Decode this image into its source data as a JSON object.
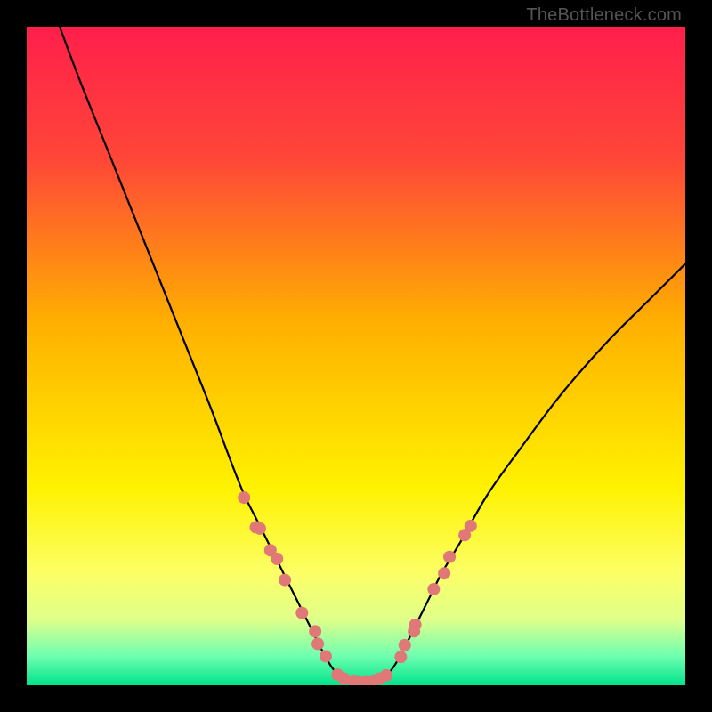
{
  "watermark": "TheBottleneck.com",
  "chart_data": {
    "type": "line",
    "title": "",
    "xlabel": "",
    "ylabel": "",
    "xlim": [
      0,
      100
    ],
    "ylim": [
      0,
      100
    ],
    "grid": false,
    "legend": false,
    "background_gradient_stops": [
      {
        "offset": 0.0,
        "color": "#ff1f4b"
      },
      {
        "offset": 0.2,
        "color": "#ff4638"
      },
      {
        "offset": 0.45,
        "color": "#ffb000"
      },
      {
        "offset": 0.7,
        "color": "#fff200"
      },
      {
        "offset": 0.83,
        "color": "#fcff66"
      },
      {
        "offset": 0.9,
        "color": "#e0ff8a"
      },
      {
        "offset": 0.955,
        "color": "#70ffb0"
      },
      {
        "offset": 1.0,
        "color": "#00e38c"
      }
    ],
    "series": [
      {
        "name": "left-curve",
        "stroke": "#000000",
        "x": [
          5,
          8,
          12,
          16,
          20,
          24,
          28,
          31,
          33,
          35,
          37,
          39,
          41,
          43,
          45,
          46.5,
          48
        ],
        "y": [
          100,
          92,
          82,
          72,
          62,
          52,
          42,
          34,
          29,
          25,
          21,
          17,
          13,
          9,
          5,
          2.5,
          1
        ]
      },
      {
        "name": "right-curve",
        "stroke": "#000000",
        "x": [
          54,
          55.5,
          57,
          59,
          61,
          63,
          66,
          70,
          75,
          81,
          88,
          95,
          100
        ],
        "y": [
          1,
          2.5,
          5,
          9,
          13,
          17,
          22,
          29,
          36,
          44,
          52,
          59,
          64
        ]
      },
      {
        "name": "valley-floor",
        "stroke": "#000000",
        "x": [
          48,
          49,
          50,
          51,
          52,
          53,
          54
        ],
        "y": [
          1,
          0.7,
          0.6,
          0.6,
          0.6,
          0.7,
          1
        ]
      }
    ],
    "markers": {
      "name": "sample-points",
      "color": "#e07878",
      "radius": 7,
      "points": [
        {
          "x": 33.0,
          "y": 28.5
        },
        {
          "x": 34.8,
          "y": 24.0
        },
        {
          "x": 35.4,
          "y": 23.8
        },
        {
          "x": 37.0,
          "y": 20.5
        },
        {
          "x": 38.0,
          "y": 19.2
        },
        {
          "x": 39.2,
          "y": 16.0
        },
        {
          "x": 41.8,
          "y": 11.0
        },
        {
          "x": 43.8,
          "y": 8.2
        },
        {
          "x": 44.2,
          "y": 6.3
        },
        {
          "x": 45.4,
          "y": 4.4
        },
        {
          "x": 47.2,
          "y": 1.6
        },
        {
          "x": 48.2,
          "y": 1.0
        },
        {
          "x": 49.6,
          "y": 0.7
        },
        {
          "x": 50.4,
          "y": 0.6
        },
        {
          "x": 51.5,
          "y": 0.6
        },
        {
          "x": 52.6,
          "y": 0.7
        },
        {
          "x": 53.5,
          "y": 1.0
        },
        {
          "x": 54.6,
          "y": 1.5
        },
        {
          "x": 56.8,
          "y": 4.3
        },
        {
          "x": 57.4,
          "y": 6.1
        },
        {
          "x": 58.8,
          "y": 8.2
        },
        {
          "x": 59.0,
          "y": 9.2
        },
        {
          "x": 61.8,
          "y": 14.6
        },
        {
          "x": 63.4,
          "y": 17.0
        },
        {
          "x": 64.2,
          "y": 19.5
        },
        {
          "x": 66.5,
          "y": 22.8
        },
        {
          "x": 67.4,
          "y": 24.2
        }
      ]
    }
  }
}
